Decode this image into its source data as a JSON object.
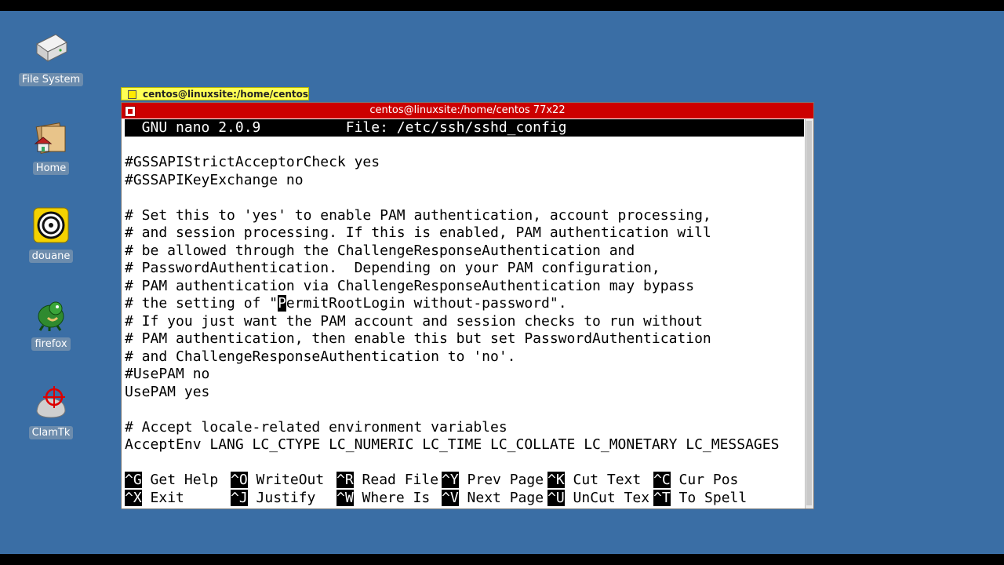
{
  "desktop": {
    "icons": [
      {
        "label": "File System",
        "icon": "drive-icon"
      },
      {
        "label": "Home",
        "icon": "home-folder-icon"
      },
      {
        "label": "douane",
        "icon": "douane-icon"
      },
      {
        "label": "firefox",
        "icon": "firefox-icon"
      },
      {
        "label": "ClamTk",
        "icon": "clamtk-icon"
      }
    ]
  },
  "taskbar": {
    "tab_label": "centos@linuxsite:/home/centos"
  },
  "window": {
    "title": "centos@linuxsite:/home/centos 77x22",
    "accent": "#cc0000"
  },
  "nano": {
    "header": "  GNU nano 2.0.9          File: /etc/ssh/sshd_config",
    "lines": [
      "",
      "#GSSAPIStrictAcceptorCheck yes",
      "#GSSAPIKeyExchange no",
      "",
      "# Set this to 'yes' to enable PAM authentication, account processing,",
      "# and session processing. If this is enabled, PAM authentication will",
      "# be allowed through the ChallengeResponseAuthentication and",
      "# PasswordAuthentication.  Depending on your PAM configuration,",
      "# PAM authentication via ChallengeResponseAuthentication may bypass",
      "",
      "# If you just want the PAM account and session checks to run without",
      "# PAM authentication, then enable this but set PasswordAuthentication",
      "# and ChallengeResponseAuthentication to 'no'.",
      "#UsePAM no",
      "UsePAM yes",
      "",
      "# Accept locale-related environment variables",
      "AcceptEnv LANG LC_CTYPE LC_NUMERIC LC_TIME LC_COLLATE LC_MONETARY LC_MESSAGES"
    ],
    "cursor_line": {
      "before": "# the setting of \"",
      "cursor_char": "P",
      "after": "ermitRootLogin without-password\"."
    },
    "shortcuts_row1": [
      {
        "key": "^G",
        "label": " Get Help "
      },
      {
        "key": "^O",
        "label": " WriteOut "
      },
      {
        "key": "^R",
        "label": " Read File"
      },
      {
        "key": "^Y",
        "label": " Prev Page"
      },
      {
        "key": "^K",
        "label": " Cut Text "
      },
      {
        "key": "^C",
        "label": " Cur Pos"
      }
    ],
    "shortcuts_row2": [
      {
        "key": "^X",
        "label": " Exit     "
      },
      {
        "key": "^J",
        "label": " Justify  "
      },
      {
        "key": "^W",
        "label": " Where Is "
      },
      {
        "key": "^V",
        "label": " Next Page"
      },
      {
        "key": "^U",
        "label": " UnCut Tex"
      },
      {
        "key": "^T",
        "label": " To Spell"
      }
    ]
  }
}
